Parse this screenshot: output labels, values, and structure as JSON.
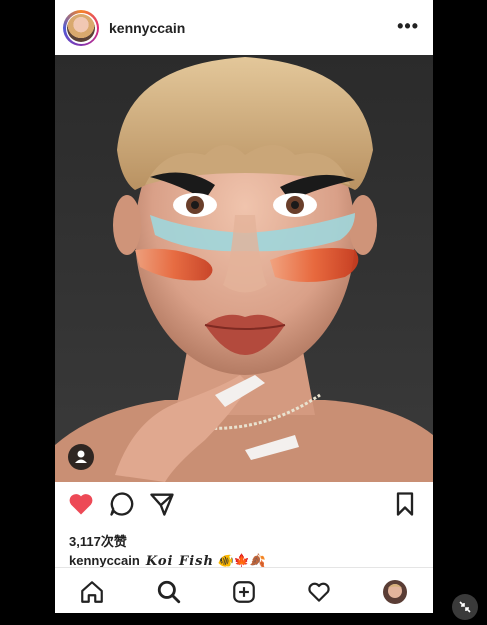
{
  "post": {
    "username": "kennyccain",
    "more_label": "•••",
    "likes": "3,117次赞",
    "caption_user": "kennyccain",
    "caption_title": "Koi Fish",
    "caption_emojis": "🐠🍁🍂"
  },
  "icons": {
    "like": "heart-icon-filled",
    "comment": "comment-icon",
    "share": "send-icon",
    "save": "bookmark-icon",
    "tag": "user-tag-icon",
    "nav": [
      "home-icon",
      "search-icon",
      "add-post-icon",
      "activity-heart-icon",
      "profile-avatar"
    ]
  },
  "colors": {
    "like_red": "#ed4956",
    "text": "#222222",
    "background": "#000000"
  }
}
